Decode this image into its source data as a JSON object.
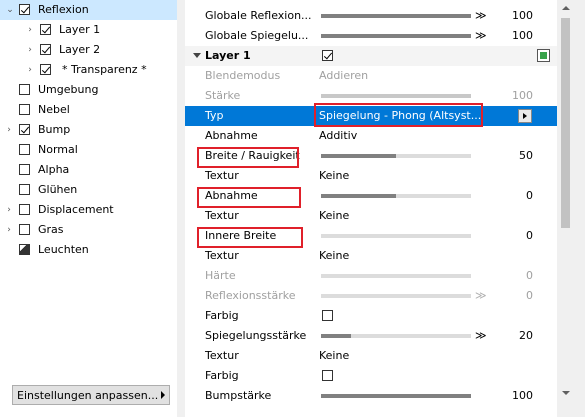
{
  "tree": {
    "items": [
      {
        "label": "Reflexion",
        "checked": true,
        "twisty": "down",
        "selected": true
      },
      {
        "label": "Layer 1",
        "checked": true,
        "twisty": "right"
      },
      {
        "label": "Layer 2",
        "checked": true,
        "twisty": "right"
      },
      {
        "label": "* Transparenz *",
        "checked": true,
        "twisty": "right"
      },
      {
        "label": "Umgebung",
        "checked": false
      },
      {
        "label": "Nebel",
        "checked": false
      },
      {
        "label": "Bump",
        "checked": true,
        "twisty": "right"
      },
      {
        "label": "Normal",
        "checked": false
      },
      {
        "label": "Alpha",
        "checked": false
      },
      {
        "label": "Glühen",
        "checked": false
      },
      {
        "label": "Displacement",
        "checked": false,
        "twisty": "right"
      },
      {
        "label": "Gras",
        "checked": false,
        "twisty": "right"
      },
      {
        "label": "Leuchten",
        "icon": "light-icon"
      }
    ]
  },
  "footer": {
    "settings_button": "Einstellungen anpassen..."
  },
  "props": {
    "globale_reflexion": {
      "label": "Globale Reflexion...",
      "value": "100",
      "fill": 1.0
    },
    "globale_spiegel": {
      "label": "Globale Spiegelu...",
      "value": "100",
      "fill": 1.0
    },
    "layer1": {
      "label": "Layer 1",
      "checked": true
    },
    "blendemodus": {
      "label": "Blendemodus",
      "value": "Addieren"
    },
    "staerke": {
      "label": "Stärke",
      "value": "100",
      "fill": 1.0
    },
    "typ": {
      "label": "Typ",
      "value": "Spiegelung - Phong (Altsyst..."
    },
    "abnahme1": {
      "label": "Abnahme",
      "value": "Additiv"
    },
    "breite": {
      "label": "Breite / Rauigkeit",
      "value": "50",
      "fill": 0.5
    },
    "textur1": {
      "label": "Textur",
      "value": "Keine"
    },
    "abnahme2": {
      "label": "Abnahme",
      "value": "0",
      "fill": 0.5
    },
    "textur2": {
      "label": "Textur",
      "value": "Keine"
    },
    "innere_breite": {
      "label": "Innere Breite",
      "value": "0",
      "fill": 0.0
    },
    "textur3": {
      "label": "Textur",
      "value": "Keine"
    },
    "haerte": {
      "label": "Härte",
      "value": "0",
      "fill": 0.0
    },
    "reflexionsstaerke": {
      "label": "Reflexionsstärke",
      "value": "0",
      "fill": 0.0
    },
    "farbig1": {
      "label": "Farbig",
      "checked": false
    },
    "spiegelungsstaerke": {
      "label": "Spiegelungsstärke",
      "value": "20",
      "fill": 0.2
    },
    "textur4": {
      "label": "Textur",
      "value": "Keine"
    },
    "farbig2": {
      "label": "Farbig",
      "checked": false
    },
    "bumpstaerke": {
      "label": "Bumpstärke",
      "value": "100",
      "fill": 1.0
    }
  },
  "colors": {
    "selection": "#0078d7",
    "tree_selection": "#cce8ff",
    "highlight_box": "#e0202a"
  }
}
